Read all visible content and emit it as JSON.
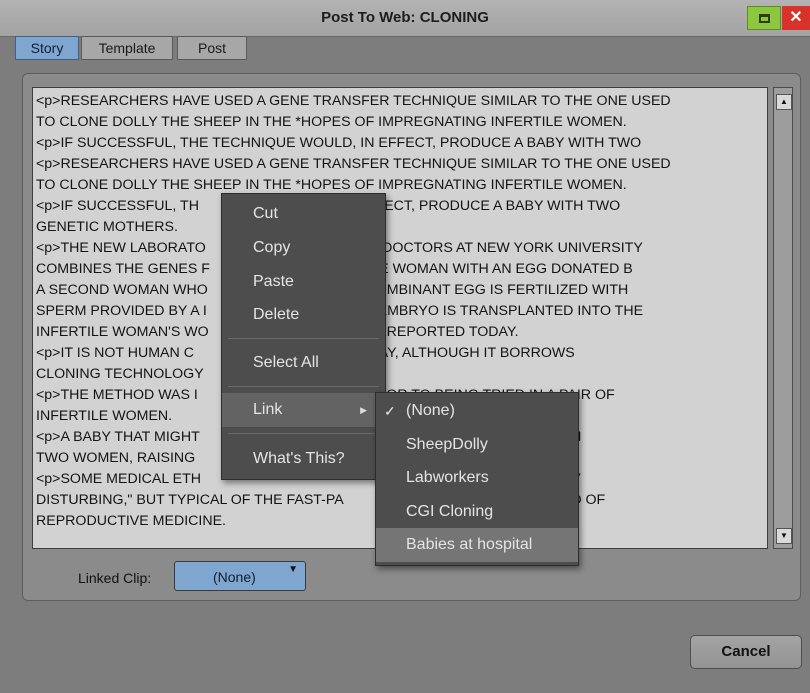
{
  "window": {
    "title": "Post To Web: CLONING",
    "minimize_icon": "maximize-square-icon",
    "close_label": "✕"
  },
  "tabs": [
    {
      "label": "Story",
      "active": true
    },
    {
      "label": "Template",
      "active": false
    },
    {
      "label": "Post",
      "active": false
    }
  ],
  "editor": {
    "lines": [
      "<p>RESEARCHERS HAVE USED A GENE TRANSFER TECHNIQUE SIMILAR TO THE ONE USED",
      "TO CLONE DOLLY THE SHEEP IN THE *HOPES OF IMPREGNATING INFERTILE WOMEN.",
      "<p>IF SUCCESSFUL, THE TECHNIQUE WOULD, IN EFFECT, PRODUCE A BABY WITH TWO",
      "<p>RESEARCHERS HAVE USED A GENE TRANSFER TECHNIQUE SIMILAR TO THE ONE USED",
      "TO CLONE DOLLY THE SHEEP IN THE *HOPES OF IMPREGNATING INFERTILE WOMEN.",
      "<p>IF SUCCESSFUL, TH                               D, IN EFFECT, PRODUCE A BABY WITH TWO",
      "GENETIC MOTHERS.",
      "<p>THE NEW LABORATO                            ERED BY DOCTORS AT NEW YORK UNIVERSITY",
      "COMBINES THE GENES F                           INFERTILE WOMAN WITH AN EGG DONATED B",
      "A SECOND WOMAN WHO                             HE RECOMBINANT EGG IS FERTILIZED WITH",
      "SPERM PROVIDED BY A I                           SULTING EMBRYO IS TRANSPLANTED INTO THE",
      "INFERTILE WOMAN'S WO                            ON POST REPORTED TODAY.",
      "<p>IT IS NOT HUMAN C                              SAID TODAY, ALTHOUGH IT BORROWS",
      "CLONING TECHNOLOGY                             MBRYO.",
      "<p>THE METHOD WAS I                               MALS PRIOR TO BEING TRIED IN A PAIR OF",
      "INFERTILE WOMEN.",
      "<p>A BABY THAT MIGHT                                                              ARRY GENES FROM",
      "TWO WOMEN, RAISING                                                              ER, OR BOTH.",
      "<p>SOME MEDICAL ETH                                                              AND \"PROFOUNDLY",
      "DISTURBING,\" BUT TYPICAL OF THE FAST-PA                                      LATED FIELD OF",
      "REPRODUCTIVE MEDICINE."
    ]
  },
  "scrollbar": {
    "up_arrow": "▲",
    "down_arrow": "▼"
  },
  "linked_clip": {
    "label": "Linked Clip:",
    "value": "(None)",
    "arrow": "▼"
  },
  "cancel_label": "Cancel",
  "context_menu": {
    "items": [
      {
        "label": "Cut"
      },
      {
        "label": "Copy"
      },
      {
        "label": "Paste"
      },
      {
        "label": "Delete"
      },
      {
        "label": "Select All"
      },
      {
        "label": "Link",
        "submenu_arrow": "▶"
      },
      {
        "label": "What's This?"
      }
    ]
  },
  "link_submenu": {
    "check": "✓",
    "items": [
      {
        "label": "(None)",
        "checked": true
      },
      {
        "label": "SheepDolly"
      },
      {
        "label": "Labworkers"
      },
      {
        "label": "CGI Cloning"
      },
      {
        "label": "Babies at hospital"
      }
    ]
  }
}
